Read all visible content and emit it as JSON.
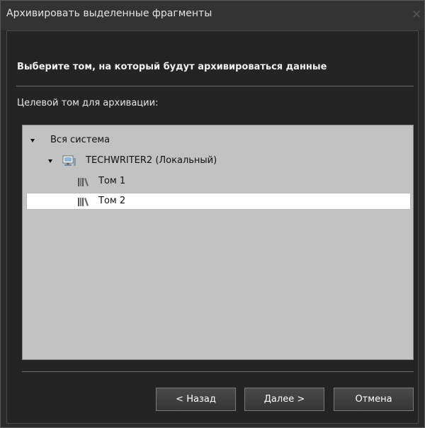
{
  "dialog": {
    "title": "Архивировать выделенные фрагменты",
    "close_icon": "close-icon"
  },
  "content": {
    "heading": "Выберите том, на который будут архивироваться данные",
    "target_label": "Целевой том для архивации:"
  },
  "tree": {
    "root": {
      "label": "Вся система",
      "expanded": true
    },
    "computer": {
      "label": "TECHWRITER2 (Локальный)",
      "icon": "computer-icon",
      "expanded": true
    },
    "volumes": [
      {
        "label": "Том 1",
        "icon": "volume-icon",
        "selected": false
      },
      {
        "label": "Том 2",
        "icon": "volume-icon",
        "selected": true
      }
    ]
  },
  "buttons": {
    "back": "< Назад",
    "next": "Далее >",
    "cancel": "Отмена"
  },
  "colors": {
    "window_background": "#2b2b2b",
    "tree_background": "#c2c2c2",
    "selection": "#ffffff"
  }
}
